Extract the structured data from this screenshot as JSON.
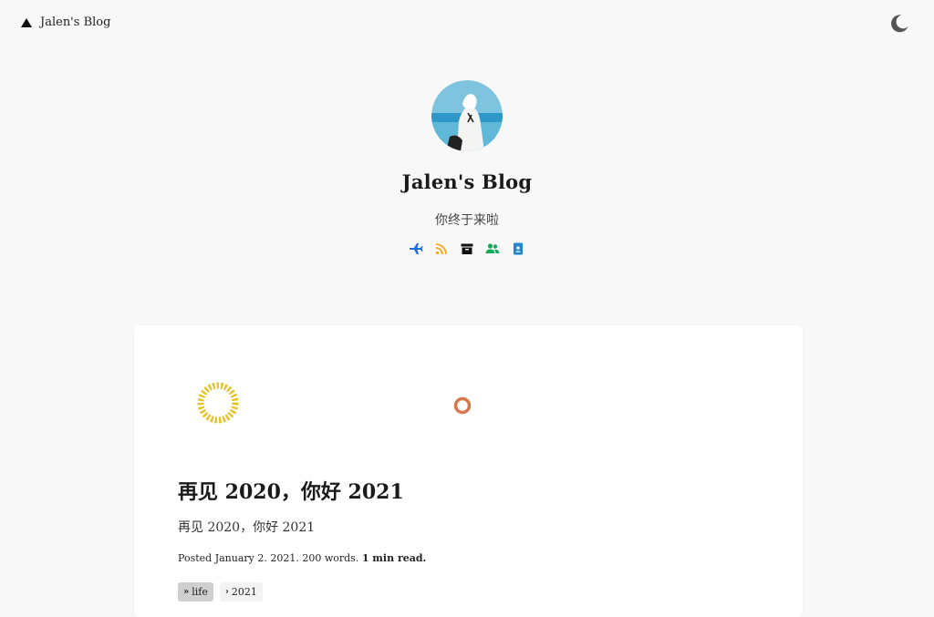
{
  "header": {
    "brand": "Jalen's Blog",
    "theme_toggle_icon": "moon-icon"
  },
  "hero": {
    "avatar": "avatar-image",
    "title": "Jalen's Blog",
    "tagline": "你终于来啦",
    "social_links": [
      {
        "icon": "plane-icon",
        "color": "#1a6fe0"
      },
      {
        "icon": "rss-icon",
        "color": "#f5a623"
      },
      {
        "icon": "archive-icon",
        "color": "#111111"
      },
      {
        "icon": "friends-icon",
        "color": "#14a85a"
      },
      {
        "icon": "contact-card-icon",
        "color": "#1f86d1"
      }
    ]
  },
  "post": {
    "title": "再见 2020，你好 2021",
    "summary": "再见 2020，你好 2021",
    "meta_prefix": "Posted January 2. 2021. 200 words.",
    "meta_read": "1 min read.",
    "tags": [
      {
        "label": "life",
        "active": true
      },
      {
        "label": "2021",
        "active": false
      }
    ]
  },
  "colors": {
    "background": "#f8f8f8",
    "card": "#ffffff",
    "sun": "#e8c327",
    "ring": "#d9774a"
  }
}
